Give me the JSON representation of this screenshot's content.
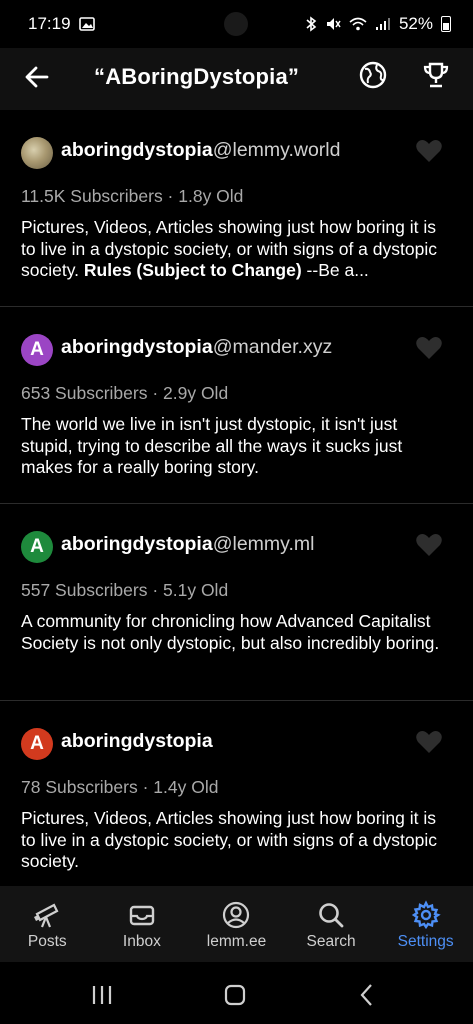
{
  "status": {
    "time": "17:19",
    "battery_text": "52%"
  },
  "header": {
    "title": "“ABoringDystopia”"
  },
  "communities": [
    {
      "local": "aboringdystopia",
      "instance": "@lemmy.world",
      "avatar_letter": "",
      "avatar_color": "",
      "meta": "11.5K Subscribers · 1.8y Old",
      "desc_text": "Pictures, Videos, Articles showing just how boring it is to live in a dystopic society, or with signs of a dystopic society. ",
      "desc_bold": "Rules (Subject to Change)",
      "desc_tail": " --Be a..."
    },
    {
      "local": "aboringdystopia",
      "instance": "@mander.xyz",
      "avatar_letter": "A",
      "avatar_color": "#9b45c4",
      "meta": "653 Subscribers · 2.9y Old",
      "desc_text": "The world we live in isn't just dystopic, it isn't just stupid, trying to describe all the ways it sucks just makes for a really boring story.",
      "desc_bold": "",
      "desc_tail": ""
    },
    {
      "local": "aboringdystopia",
      "instance": "@lemmy.ml",
      "avatar_letter": "A",
      "avatar_color": "#1e8a3c",
      "meta": "557 Subscribers · 5.1y Old",
      "desc_text": "A community for chronicling how Advanced Capitalist Society is not only dystopic, but also incredibly boring.",
      "desc_bold": "",
      "desc_tail": ""
    },
    {
      "local": "aboringdystopia",
      "instance": "",
      "avatar_letter": "A",
      "avatar_color": "#d23a1e",
      "meta": "78 Subscribers · 1.4y Old",
      "desc_text": "Pictures, Videos, Articles showing just how boring it is to live in a dystopic society, or with signs of a dystopic society.",
      "desc_bold": "",
      "desc_tail": ""
    }
  ],
  "nav": {
    "posts": "Posts",
    "inbox": "Inbox",
    "account": "lemm.ee",
    "search": "Search",
    "settings": "Settings"
  },
  "colors": {
    "accent": "#4d8ff5",
    "background": "#000000",
    "bar": "#111111"
  },
  "icons": [
    "back-arrow-icon",
    "globe-icon",
    "trophy-icon",
    "heart-icon",
    "telescope-icon",
    "inbox-icon",
    "account-icon",
    "search-icon",
    "gear-icon"
  ]
}
